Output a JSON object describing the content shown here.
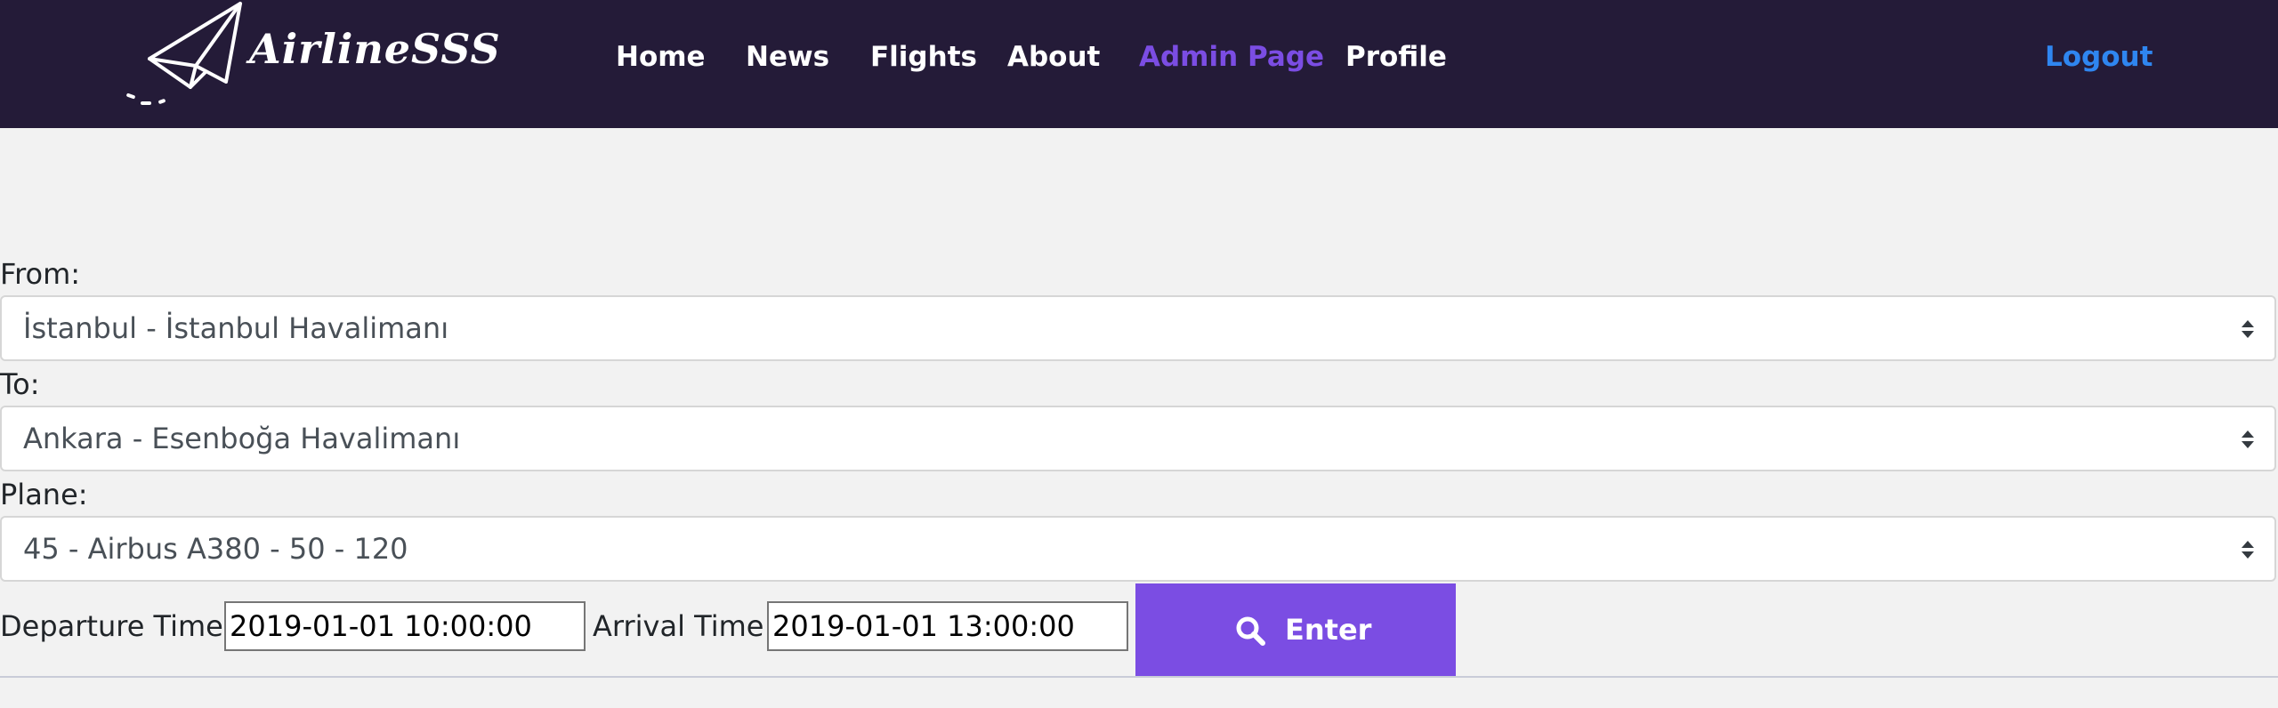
{
  "navbar": {
    "brand": "AirlineSSS",
    "links": [
      {
        "label": "Home"
      },
      {
        "label": "News"
      },
      {
        "label": "Flights"
      },
      {
        "label": "About"
      },
      {
        "label": "Admin Page",
        "active": true
      },
      {
        "label": "Profile"
      }
    ],
    "logout": "Logout"
  },
  "form": {
    "from": {
      "label": "From:",
      "value": "İstanbul - İstanbul Havalimanı"
    },
    "to": {
      "label": "To:",
      "value": "Ankara - Esenboğa Havalimanı"
    },
    "plane": {
      "label": "Plane:",
      "value": "45 - Airbus A380 - 50 - 120"
    },
    "departure": {
      "label": "Departure Time:",
      "value": "2019-01-01 10:00:00"
    },
    "arrival": {
      "label": "Arrival Time:",
      "value": "2019-01-01 13:00:00"
    },
    "submit_label": "Enter"
  },
  "colors": {
    "navbar_bg": "#241b38",
    "accent": "#7b4de3",
    "logout": "#2f86f0",
    "page_bg": "#f2f2f2"
  },
  "icons": {
    "logo": "paper-plane-icon",
    "select_arrow": "sort-arrows-icon",
    "submit": "search-icon"
  }
}
